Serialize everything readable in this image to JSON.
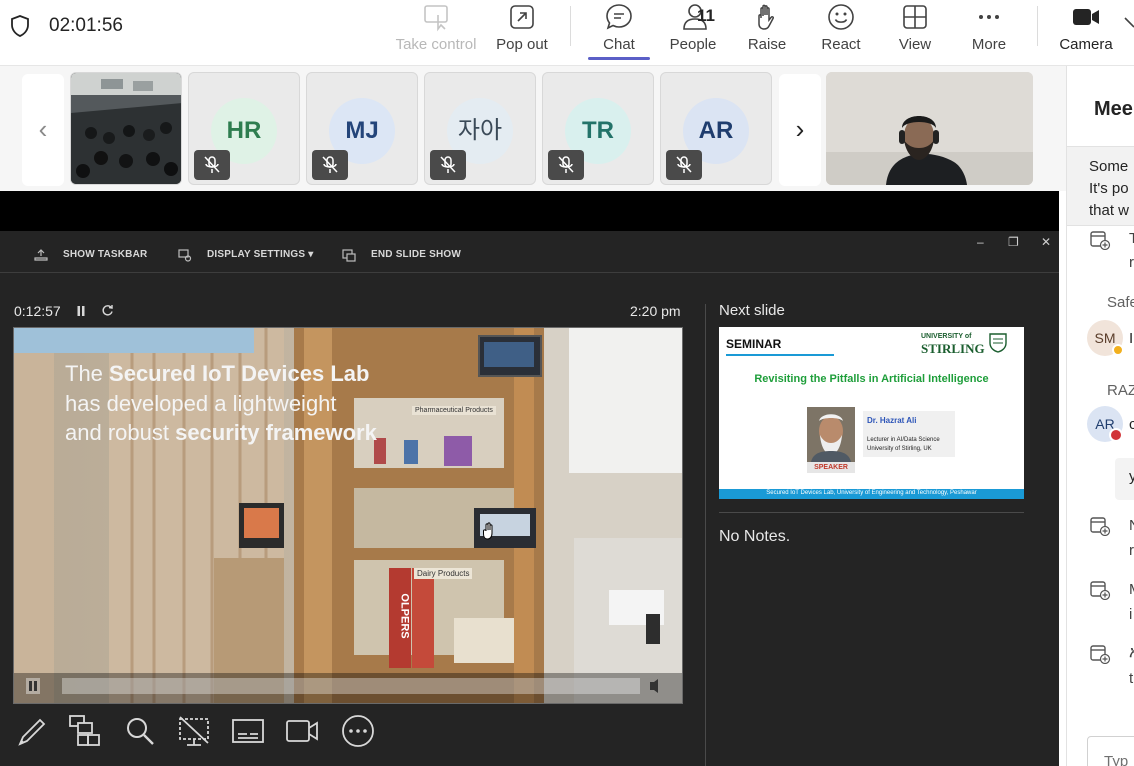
{
  "meeting": {
    "timer": "02:01:56"
  },
  "toolbar": {
    "take_control": "Take control",
    "pop_out": "Pop out",
    "chat": "Chat",
    "people": "People",
    "people_count": "11",
    "raise": "Raise",
    "react": "React",
    "view": "View",
    "more": "More",
    "camera": "Camera"
  },
  "gallery": {
    "participants": [
      {
        "initials": "HR",
        "bg": "#dff2e6",
        "fg": "#2e7d4f"
      },
      {
        "initials": "MJ",
        "bg": "#dce6f5",
        "fg": "#24457a"
      },
      {
        "initials": "자아",
        "bg": "#e4ecf2",
        "fg": "#3b4a58"
      },
      {
        "initials": "TR",
        "bg": "#d9f0ee",
        "fg": "#237369"
      },
      {
        "initials": "AR",
        "bg": "#dbe4f3",
        "fg": "#1f3d6e"
      }
    ]
  },
  "side_panel": {
    "title": "Mee",
    "notice_lines": [
      "Some",
      "It's po",
      "that w"
    ],
    "items": [
      {
        "type": "event",
        "text": "T",
        "text2": "r"
      },
      {
        "type": "name",
        "text": "Safe"
      },
      {
        "type": "avatar",
        "initials": "SM",
        "text": "I"
      },
      {
        "type": "name",
        "text": "RAZ"
      },
      {
        "type": "avatar",
        "initials": "AR",
        "text": "c"
      },
      {
        "type": "bubble",
        "text": "y"
      },
      {
        "type": "event",
        "text": "N",
        "text2": "r"
      },
      {
        "type": "event",
        "text": "M",
        "text2": "i"
      },
      {
        "type": "event",
        "text": "አ",
        "text2": "t"
      }
    ],
    "compose_placeholder": "Typ"
  },
  "slideshow": {
    "show_taskbar": "SHOW TASKBAR",
    "display_settings": "DISPLAY SETTINGS ▾",
    "end_slide_show": "END SLIDE SHOW",
    "elapsed": "0:12:57",
    "clock": "2:20 pm",
    "next_slide_label": "Next slide",
    "notes": "No Notes."
  },
  "current_slide": {
    "line1_light": "The ",
    "line1_bold": "Secured IoT Devices Lab",
    "line2": "has developed a lightweight",
    "line3_light": "and robust ",
    "line3_bold": "security framework",
    "shelf_label1": "Pharmaceutical Products",
    "shelf_label2": "Dairy Products",
    "box_text": "OLPERS"
  },
  "next_slide": {
    "tag": "SEMINAR",
    "university_small": "UNIVERSITY of",
    "university": "STIRLING",
    "title": "Revisiting the Pitfalls in Artificial Intelligence",
    "speaker_name": "Dr. Hazrat Ali",
    "speaker_role": "Lecturer in AI/Data Science",
    "speaker_org": "University of Stirling, UK",
    "speaker_badge": "SPEAKER",
    "footer": "Secured IoT Devices Lab, University of Engineering and Technology, Peshawar"
  },
  "icons": {
    "tools": [
      "pen-icon",
      "slides-grid-icon",
      "zoom-icon",
      "black-screen-icon",
      "subtitles-icon",
      "camera-toggle-icon",
      "more-options-icon"
    ]
  },
  "colors": {
    "accent": "#5b5fc7",
    "slide_title_green": "#1e9e3a",
    "speaker_blue": "#2d55b8",
    "footer_blue": "#1a9ad6"
  }
}
